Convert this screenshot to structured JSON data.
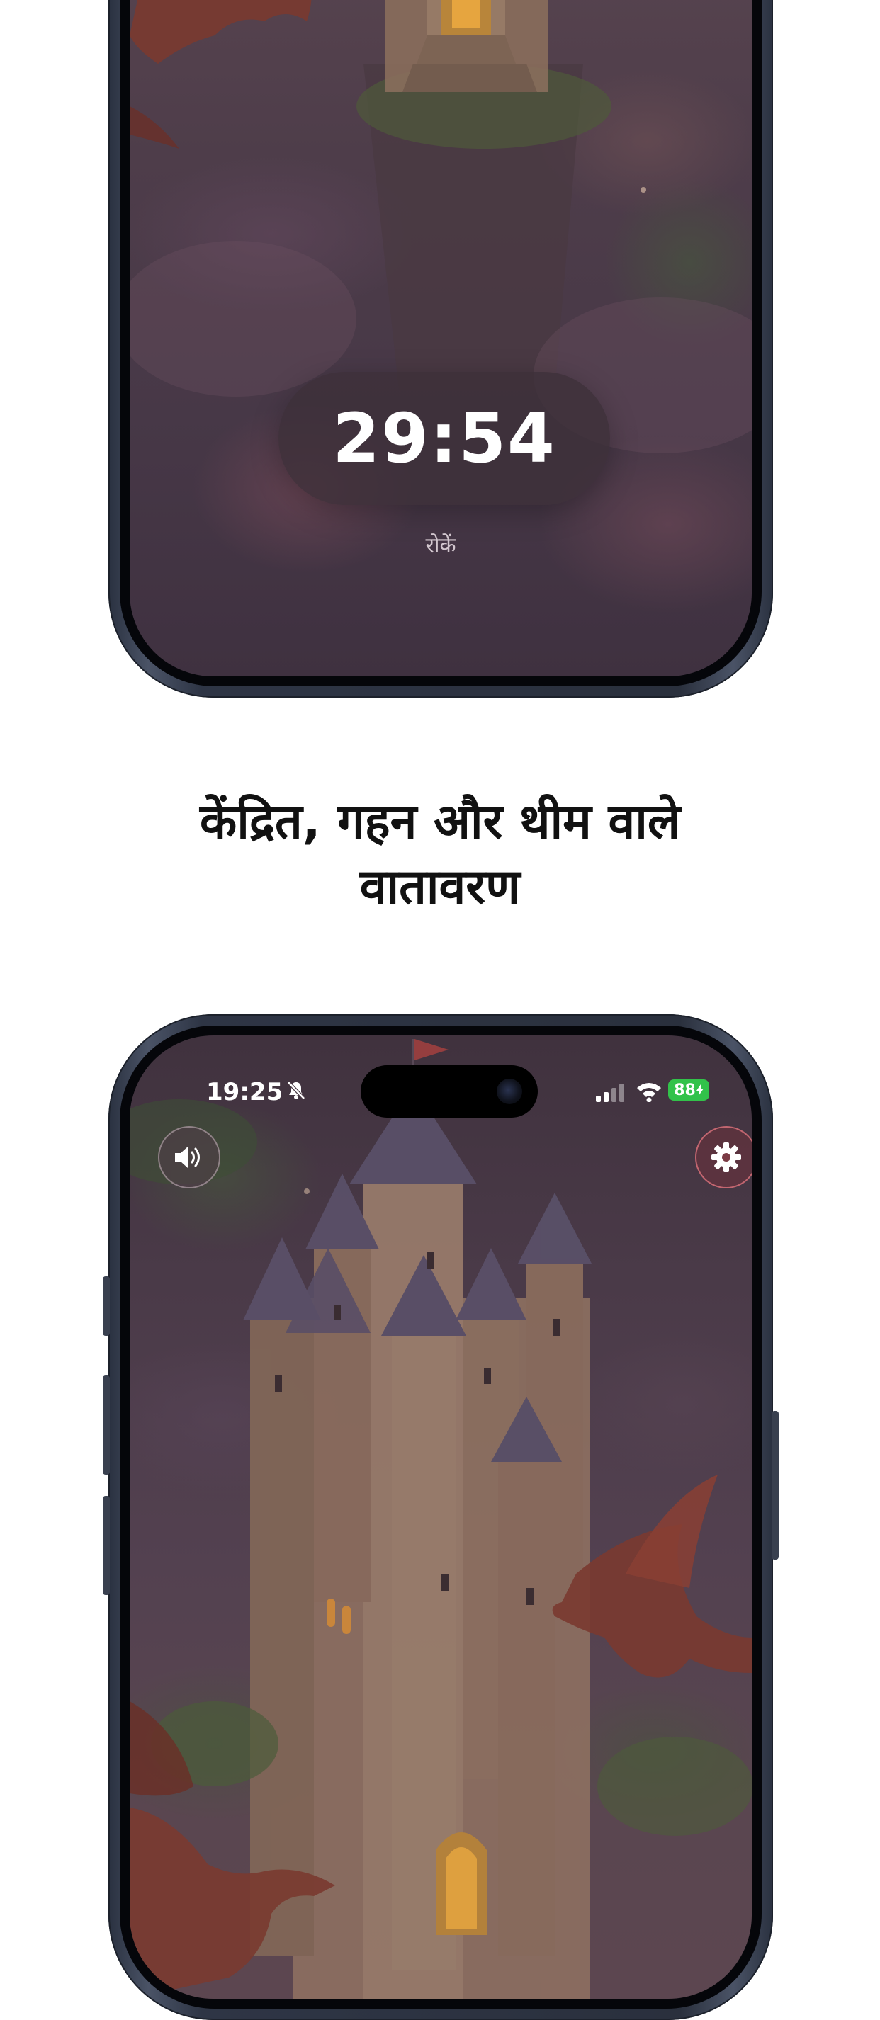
{
  "top_screen": {
    "timer": "29:54",
    "stop_label": "रोकें"
  },
  "headline": {
    "line1": "केंद्रित, गहन और थीम वाले",
    "line2": "वातावरण"
  },
  "bottom_screen": {
    "status_bar": {
      "time": "19:25",
      "silent_icon": "bell-slash-icon",
      "signal_icon": "cellular-signal-icon",
      "wifi_icon": "wifi-icon",
      "battery": "88"
    },
    "sound_button_icon": "speaker-icon",
    "settings_button_icon": "gear-icon"
  },
  "colors": {
    "battery": "#32c24a",
    "settings_ring": "#e67882",
    "frame": "#2e3545"
  }
}
